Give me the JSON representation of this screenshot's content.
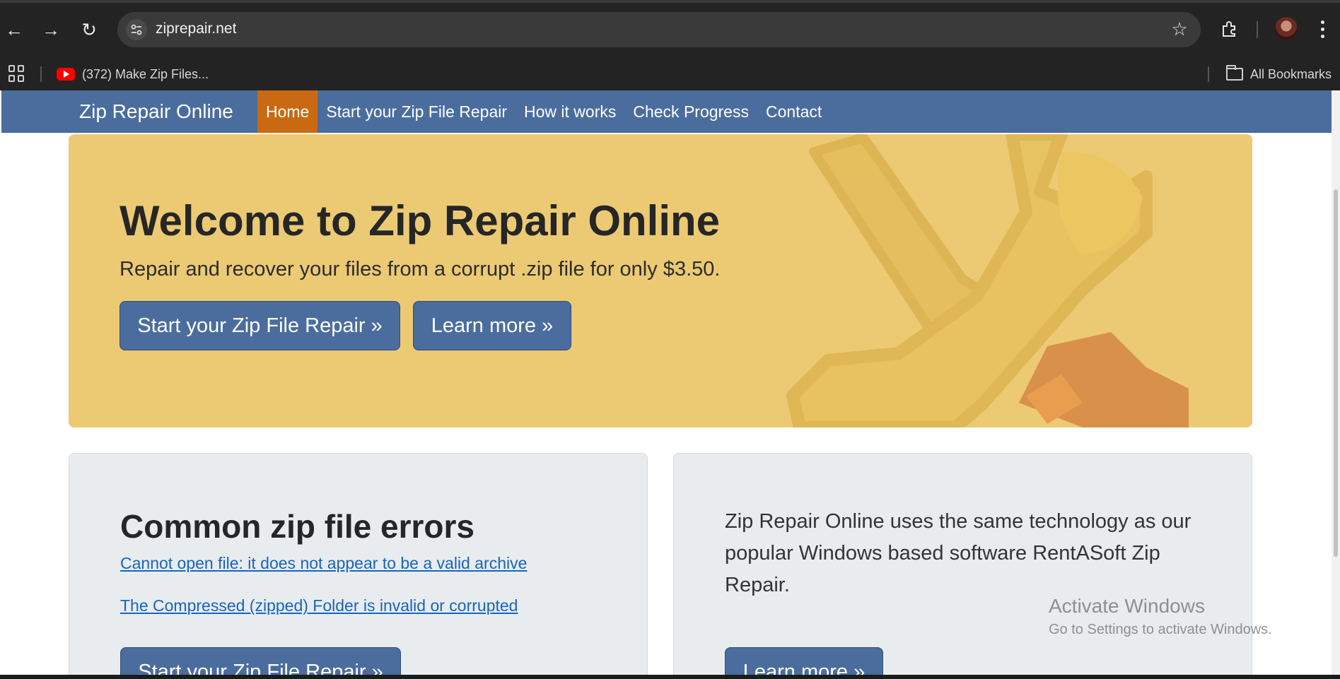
{
  "browser": {
    "url": "ziprepair.net",
    "bookmark_label": "(372) Make Zip Files...",
    "all_bookmarks_label": "All Bookmarks",
    "back_glyph": "←",
    "forward_glyph": "→",
    "reload_glyph": "↻",
    "star_glyph": "☆"
  },
  "navbar": {
    "brand": "Zip Repair Online",
    "links": [
      {
        "label": "Home",
        "active": true
      },
      {
        "label": "Start your Zip File Repair",
        "active": false
      },
      {
        "label": "How it works",
        "active": false
      },
      {
        "label": "Check Progress",
        "active": false
      },
      {
        "label": "Contact",
        "active": false
      }
    ]
  },
  "hero": {
    "title": "Welcome to Zip Repair Online",
    "subtitle": "Repair and recover your files from a corrupt .zip file for only $3.50.",
    "start_button": "Start your Zip File Repair »",
    "learn_button": "Learn more »"
  },
  "errors_card": {
    "title": "Common zip file errors",
    "links": [
      "Cannot open file: it does not appear to be a valid archive",
      "The Compressed (zipped) Folder is invalid or corrupted"
    ],
    "start_button": "Start your Zip File Repair »"
  },
  "info_card": {
    "text": "Zip Repair Online uses the same technology as our popular Windows based software RentASoft Zip Repair.",
    "learn_button": "Learn more »"
  },
  "watermark": {
    "title": "Activate Windows",
    "subtitle": "Go to Settings to activate Windows."
  },
  "colors": {
    "navbar": "#4a6d9e",
    "active_tab": "#c96a12",
    "hero_bg": "#ecca74",
    "button": "#4a6d9e",
    "link": "#1565c0"
  }
}
